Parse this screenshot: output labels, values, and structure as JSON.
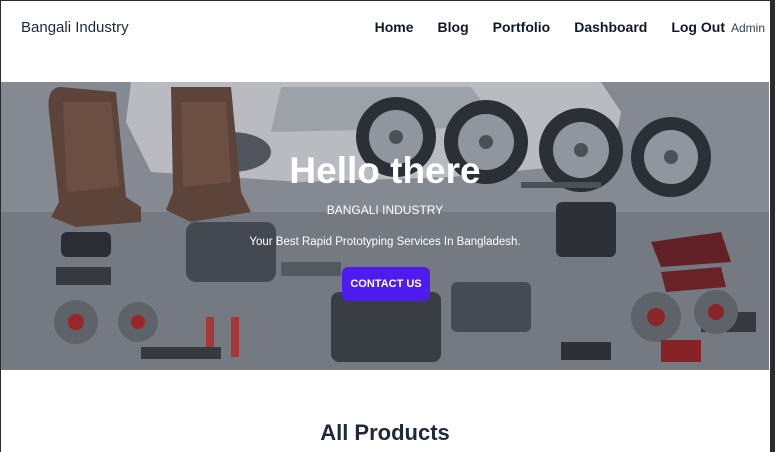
{
  "navbar": {
    "brand": "Bangali Industry",
    "links": [
      "Home",
      "Blog",
      "Portfolio",
      "Dashboard",
      "Log Out"
    ],
    "user_label": "Admin"
  },
  "hero": {
    "title": "Hello there",
    "subtitle": "BANGALI INDUSTRY",
    "tagline": "Your Best Rapid Prototyping Services In Bangladesh.",
    "cta_label": "CONTACT US",
    "cta_color": "#4f1cf0",
    "background_image": "car-parts-photo"
  },
  "products": {
    "heading": "All Products"
  }
}
